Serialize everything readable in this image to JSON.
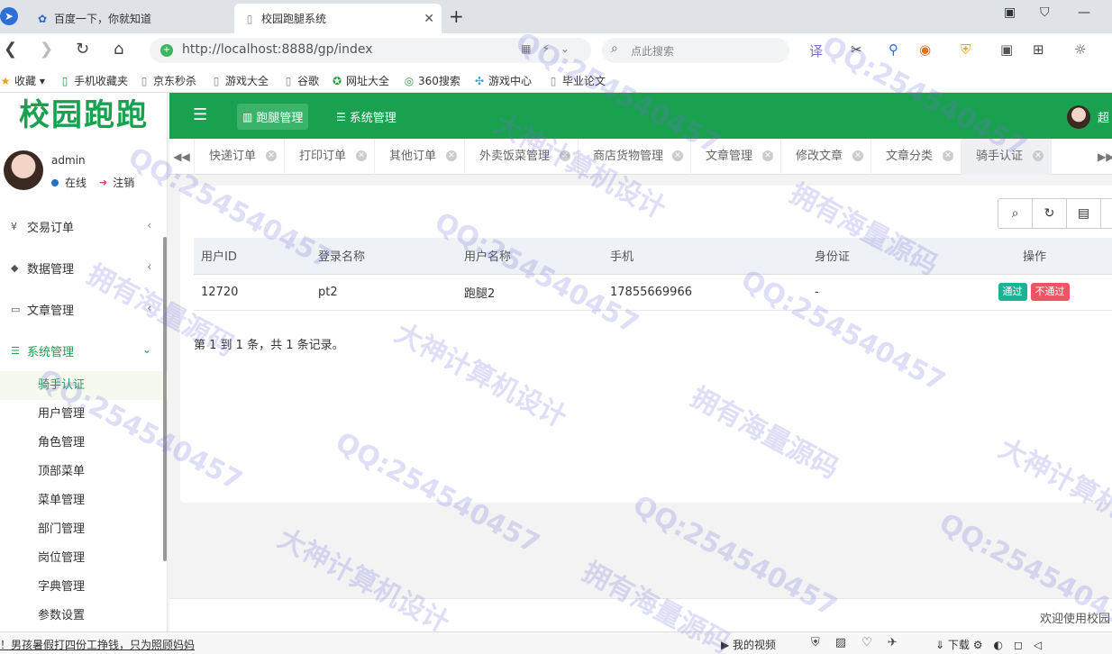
{
  "browser": {
    "tabs": [
      {
        "label": "百度一下，你就知道"
      },
      {
        "label": "校园跑腿系统"
      }
    ],
    "url": "http://localhost:8888/gp/index",
    "search_placeholder": "点此搜索",
    "bookmarks": [
      "收藏",
      "手机收藏夹",
      "京东秒杀",
      "游戏大全",
      "谷歌",
      "网址大全",
      "360搜索",
      "游戏中心",
      "毕业论文"
    ]
  },
  "app": {
    "logo": "校园跑跑",
    "user": {
      "name": "admin",
      "status": "在线",
      "logout": "注销"
    },
    "menu": [
      {
        "label": "交易订单"
      },
      {
        "label": "数据管理"
      },
      {
        "label": "文章管理"
      },
      {
        "label": "系统管理"
      }
    ],
    "submenu": [
      "骑手认证",
      "用户管理",
      "角色管理",
      "顶部菜单",
      "菜单管理",
      "部门管理",
      "岗位管理",
      "字典管理",
      "参数设置"
    ],
    "topnav": [
      {
        "label": "跑腿管理"
      },
      {
        "label": "系统管理"
      }
    ],
    "top_user": "超",
    "page_tabs": [
      "快递订单",
      "打印订单",
      "其他订单",
      "外卖饭菜管理",
      "商店货物管理",
      "文章管理",
      "修改文章",
      "文章分类",
      "骑手认证"
    ],
    "table": {
      "headers": [
        "用户ID",
        "登录名称",
        "用户名称",
        "手机",
        "身份证",
        "操作"
      ],
      "rows": [
        {
          "id": "12720",
          "login": "pt2",
          "name": "跑腿2",
          "phone": "17855669966",
          "idcard": "-",
          "pass": "通过",
          "fail": "不通过"
        }
      ]
    },
    "pager_info": "第 1 到 1 条，共 1 条记录。",
    "footer": "欢迎使用校园"
  },
  "statusbar": {
    "news": "！男孩暑假打四份工挣钱，只为照顾妈妈",
    "video": "我的视频",
    "download": "下载"
  },
  "watermark": {
    "qq": "QQ:254540457",
    "cn1": "大神计算机设计",
    "cn2": "拥有海量源码"
  }
}
